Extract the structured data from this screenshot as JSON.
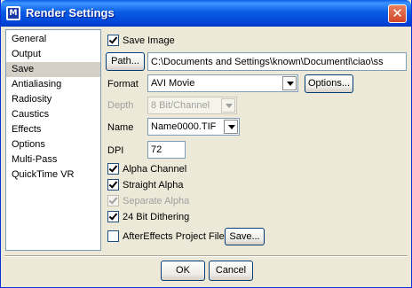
{
  "window": {
    "title": "Render Settings",
    "close_glyph": "✕",
    "app_icon_glyph": "M"
  },
  "sidebar": {
    "items": [
      {
        "label": "General"
      },
      {
        "label": "Output"
      },
      {
        "label": "Save",
        "selected": true
      },
      {
        "label": "Antialiasing"
      },
      {
        "label": "Radiosity"
      },
      {
        "label": "Caustics"
      },
      {
        "label": "Effects"
      },
      {
        "label": "Options"
      },
      {
        "label": "Multi-Pass"
      },
      {
        "label": "QuickTime VR"
      }
    ]
  },
  "save_panel": {
    "save_image": {
      "label": "Save Image",
      "checked": true
    },
    "path": {
      "button": "Path...",
      "value": "C:\\Documents and Settings\\known\\Documenti\\ciao\\ss"
    },
    "format": {
      "label": "Format",
      "value": "AVI Movie",
      "options_button": "Options..."
    },
    "depth": {
      "label": "Depth",
      "value": "8 Bit/Channel",
      "enabled": false
    },
    "name": {
      "label": "Name",
      "value": "Name0000.TIF"
    },
    "dpi": {
      "label": "DPI",
      "value": "72"
    },
    "alpha_channel": {
      "label": "Alpha Channel",
      "checked": true
    },
    "straight_alpha": {
      "label": "Straight Alpha",
      "checked": true
    },
    "separate_alpha": {
      "label": "Separate Alpha",
      "checked": true,
      "enabled": false
    },
    "dithering": {
      "label": "24 Bit Dithering",
      "checked": true
    },
    "aftereffects": {
      "label": "AfterEffects Project File",
      "checked": false,
      "save_button": "Save..."
    }
  },
  "footer": {
    "ok": "OK",
    "cancel": "Cancel"
  }
}
